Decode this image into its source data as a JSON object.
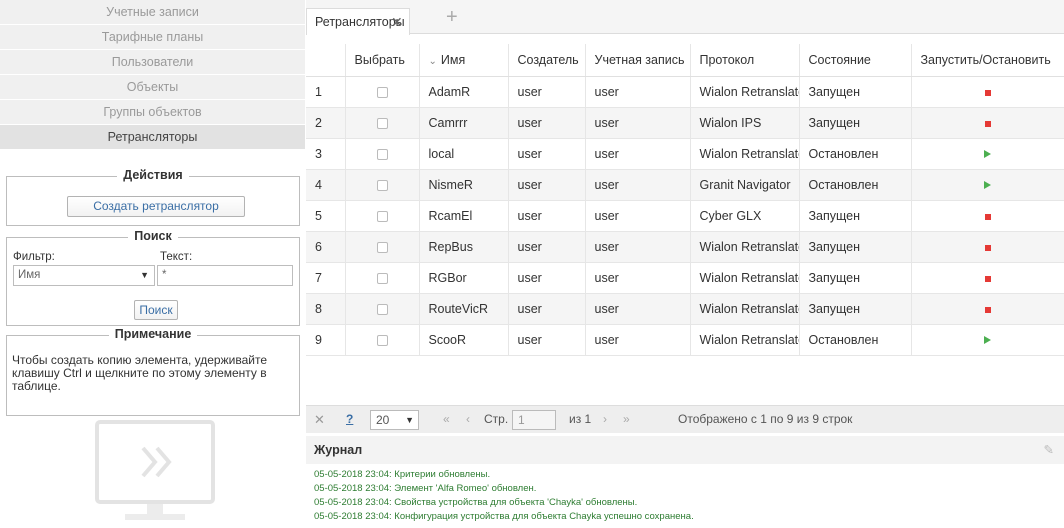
{
  "nav": [
    {
      "label": "Учетные записи",
      "active": false
    },
    {
      "label": "Тарифные планы",
      "active": false
    },
    {
      "label": "Пользователи",
      "active": false
    },
    {
      "label": "Объекты",
      "active": false
    },
    {
      "label": "Группы объектов",
      "active": false
    },
    {
      "label": "Ретрансляторы",
      "active": true
    }
  ],
  "actions": {
    "legend": "Действия",
    "create_label": "Создать ретранслятор"
  },
  "search": {
    "legend": "Поиск",
    "filter_label": "Фильтр:",
    "text_label": "Текст:",
    "filter_value": "Имя",
    "text_value": "*",
    "button_label": "Поиск"
  },
  "note": {
    "legend": "Примечание",
    "text": "Чтобы создать копию элемента, удерживайте клавишу Ctrl и щелкните по этому элементу в таблице."
  },
  "tab": {
    "label": "Ретрансляторы",
    "close": "✕",
    "add": "+"
  },
  "table": {
    "headers": [
      "",
      "Выбрать",
      "Имя",
      "Создатель",
      "Учетная запись",
      "Протокол",
      "Состояние",
      "Запустить/Остановить"
    ],
    "sort_indicator": "⌄",
    "rows": [
      {
        "n": "1",
        "name": "AdamR",
        "creator": "user",
        "account": "user",
        "protocol": "Wialon Retranslator",
        "state": "Запущен",
        "action": "stop"
      },
      {
        "n": "2",
        "name": "Camrrr",
        "creator": "user",
        "account": "user",
        "protocol": "Wialon IPS",
        "state": "Запущен",
        "action": "stop"
      },
      {
        "n": "3",
        "name": "local",
        "creator": "user",
        "account": "user",
        "protocol": "Wialon Retranslator",
        "state": "Остановлен",
        "action": "play"
      },
      {
        "n": "4",
        "name": "NismeR",
        "creator": "user",
        "account": "user",
        "protocol": "Granit Navigator",
        "state": "Остановлен",
        "action": "play"
      },
      {
        "n": "5",
        "name": "RcamEl",
        "creator": "user",
        "account": "user",
        "protocol": "Cyber GLX",
        "state": "Запущен",
        "action": "stop"
      },
      {
        "n": "6",
        "name": "RepBus",
        "creator": "user",
        "account": "user",
        "protocol": "Wialon Retranslator",
        "state": "Запущен",
        "action": "stop"
      },
      {
        "n": "7",
        "name": "RGBor",
        "creator": "user",
        "account": "user",
        "protocol": "Wialon Retranslator",
        "state": "Запущен",
        "action": "stop"
      },
      {
        "n": "8",
        "name": "RouteVicR",
        "creator": "user",
        "account": "user",
        "protocol": "Wialon Retranslator",
        "state": "Запущен",
        "action": "stop"
      },
      {
        "n": "9",
        "name": "ScooR",
        "creator": "user",
        "account": "user",
        "protocol": "Wialon Retranslator",
        "state": "Остановлен",
        "action": "play"
      }
    ]
  },
  "pager": {
    "close": "✕",
    "help": "?",
    "page_size": "20",
    "first": "«",
    "prev": "‹",
    "page_label": "Стр.",
    "page_value": "1",
    "of_label": "из 1",
    "next": "›",
    "last": "»",
    "summary": "Отображено с 1 по 9 из 9 строк"
  },
  "journal": {
    "title": "Журнал",
    "entries": [
      "05-05-2018 23:04: Критерии обновлены.",
      "05-05-2018 23:04: Элемент 'Alfa Romeo' обновлен.",
      "05-05-2018 23:04: Свойства устройства для объекта 'Chayka' обновлены.",
      "05-05-2018 23:04: Конфигурация устройства для объекта Chayka успешно сохранена."
    ]
  },
  "colors": {
    "stop": "#e53935",
    "play": "#4caf50",
    "log": "#2e7d32",
    "link": "#3a6ea5"
  },
  "icons": {
    "stop": "stop-icon",
    "play": "play-icon",
    "monitor": "monitor-icon",
    "clear": "eraser-icon"
  }
}
